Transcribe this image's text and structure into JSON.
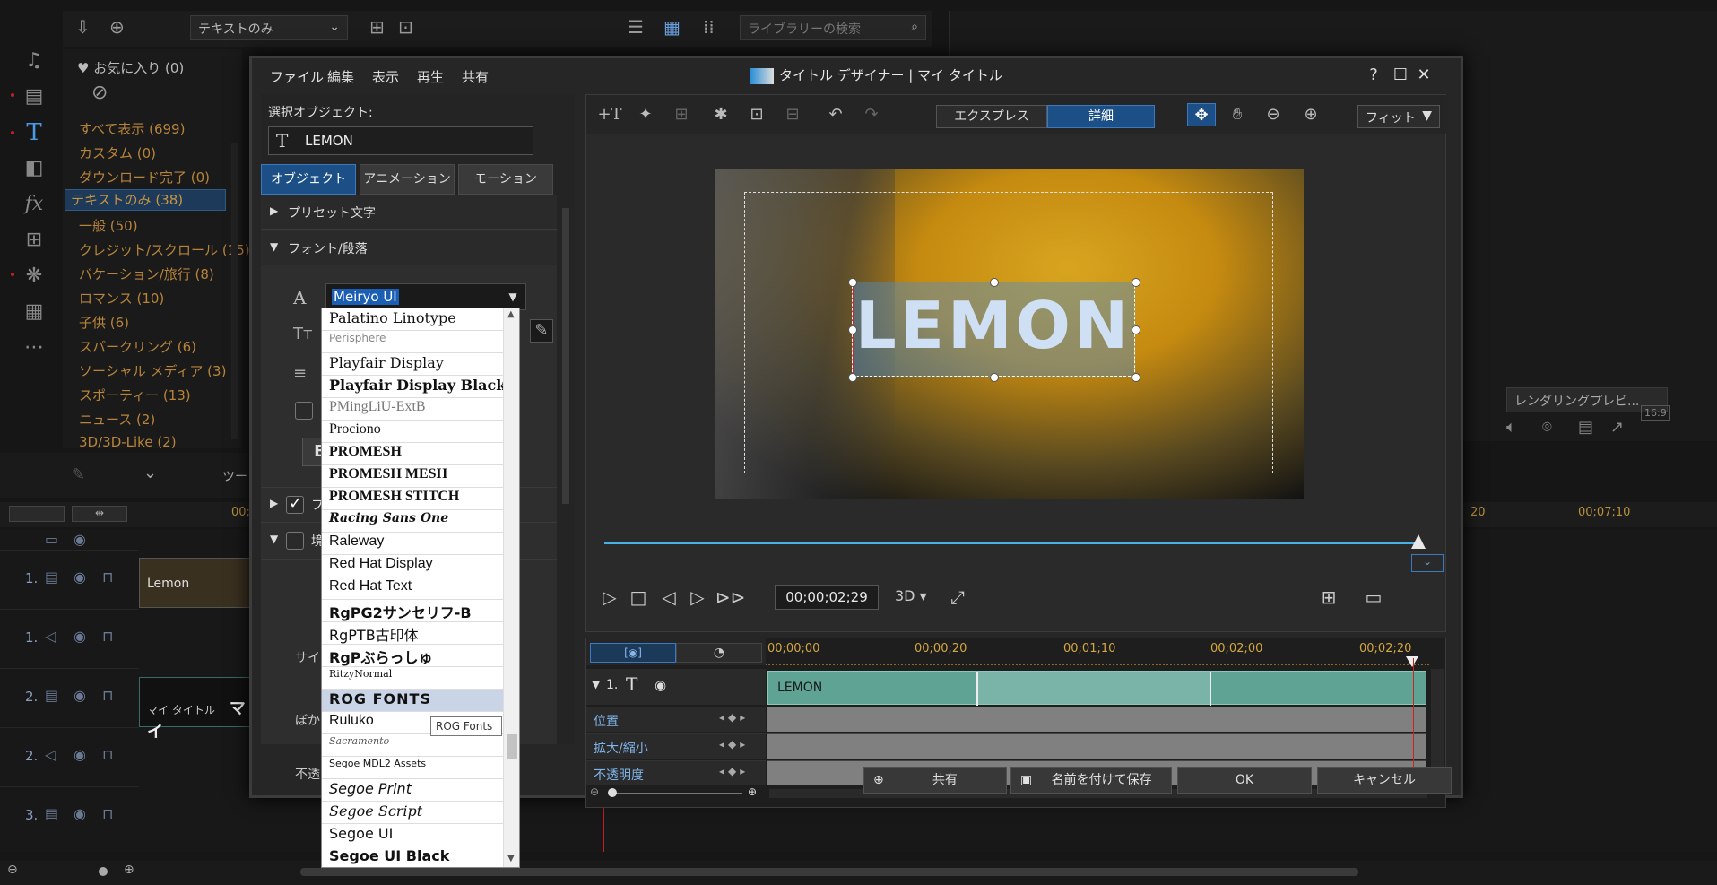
{
  "background": {
    "toolbar": {
      "view_dropdown": "テキストのみ",
      "search_placeholder": "ライブラリーの検索"
    },
    "library": {
      "favorites": "お気に入り (0)",
      "items": [
        "すべて表示 (699)",
        "カスタム (0)",
        "ダウンロード完了 (0)",
        "テキストのみ (38)",
        "一般 (50)",
        "クレジット/スクロール (15)",
        "バケーション/旅行 (8)",
        "ロマンス (10)",
        "子供 (6)",
        "スパークリング (6)",
        "ソーシャル メディア (3)",
        "スポーティー (13)",
        "ニュース (2)",
        "3D/3D-Like (2)"
      ]
    },
    "render_preview_btn": "レンダリングプレビ...",
    "aspect": "16:9",
    "tools_label": "ツー",
    "ruler_ticks": [
      "00;",
      "20",
      "00;07;10"
    ],
    "tracks": [
      {
        "num": "1."
      },
      {
        "num": "1."
      },
      {
        "num": "2."
      },
      {
        "num": "2."
      },
      {
        "num": "3."
      }
    ],
    "clip1_label": "Lemon",
    "clip2_label": "マイ タイトル",
    "clip2_label_big": "マイ",
    "left_labels": {
      "size": "サイ",
      "blur": "ぼか",
      "opacity": "不透"
    }
  },
  "dialog": {
    "menu": [
      "ファイル",
      "編集",
      "表示",
      "再生",
      "共有"
    ],
    "caption": "タイトル デザイナー | マイ タイトル",
    "win_buttons": [
      "?",
      "☐",
      "✕"
    ],
    "selected_object_label": "選択オブジェクト:",
    "selected_object_name": "LEMON",
    "tabs": [
      "オブジェクト",
      "アニメーション",
      "モーション"
    ],
    "sections": [
      "プリセット文字",
      "フォント/段落",
      "フ",
      "境"
    ],
    "font_value": "Meiryo UI",
    "font_list": [
      "Palatino Linotype",
      "Perisphere",
      "Playfair Display",
      "Playfair Display Black",
      "PMingLiU-ExtB",
      "Prociono",
      "PROMESH",
      "PROMESH MESH",
      "PROMESH STITCH",
      "Racing Sans One",
      "Raleway",
      "Red Hat Display",
      "Red Hat Text",
      "RgPG2サンセリフ-B",
      "RgPTB古印体",
      "RgPぶらっしゅ",
      "RitzyNormal",
      "ROG FONTS",
      "Ruluko",
      "Sacramento",
      "Segoe MDL2 Assets",
      "Segoe Print",
      "Segoe Script",
      "Segoe UI",
      "Segoe UI Black"
    ],
    "tooltip": "ROG Fonts",
    "bold_label": "B",
    "mode_express": "エクスプレス",
    "mode_detail": "詳細",
    "fit": "フィット",
    "title_text": "LEMON",
    "timecode": "00;00;02;29",
    "three_d": "3D",
    "timeline": {
      "ruler": [
        "00;00;00",
        "00;00;20",
        "00;01;10",
        "00;02;00",
        "00;02;20"
      ],
      "track_num": "1.",
      "clip_label": "LEMON",
      "keyframes": [
        "位置",
        "拡大/縮小",
        "不透明度"
      ]
    },
    "buttons": {
      "share": "共有",
      "save_as": "名前を付けて保存",
      "ok": "OK",
      "cancel": "キャンセル"
    }
  }
}
